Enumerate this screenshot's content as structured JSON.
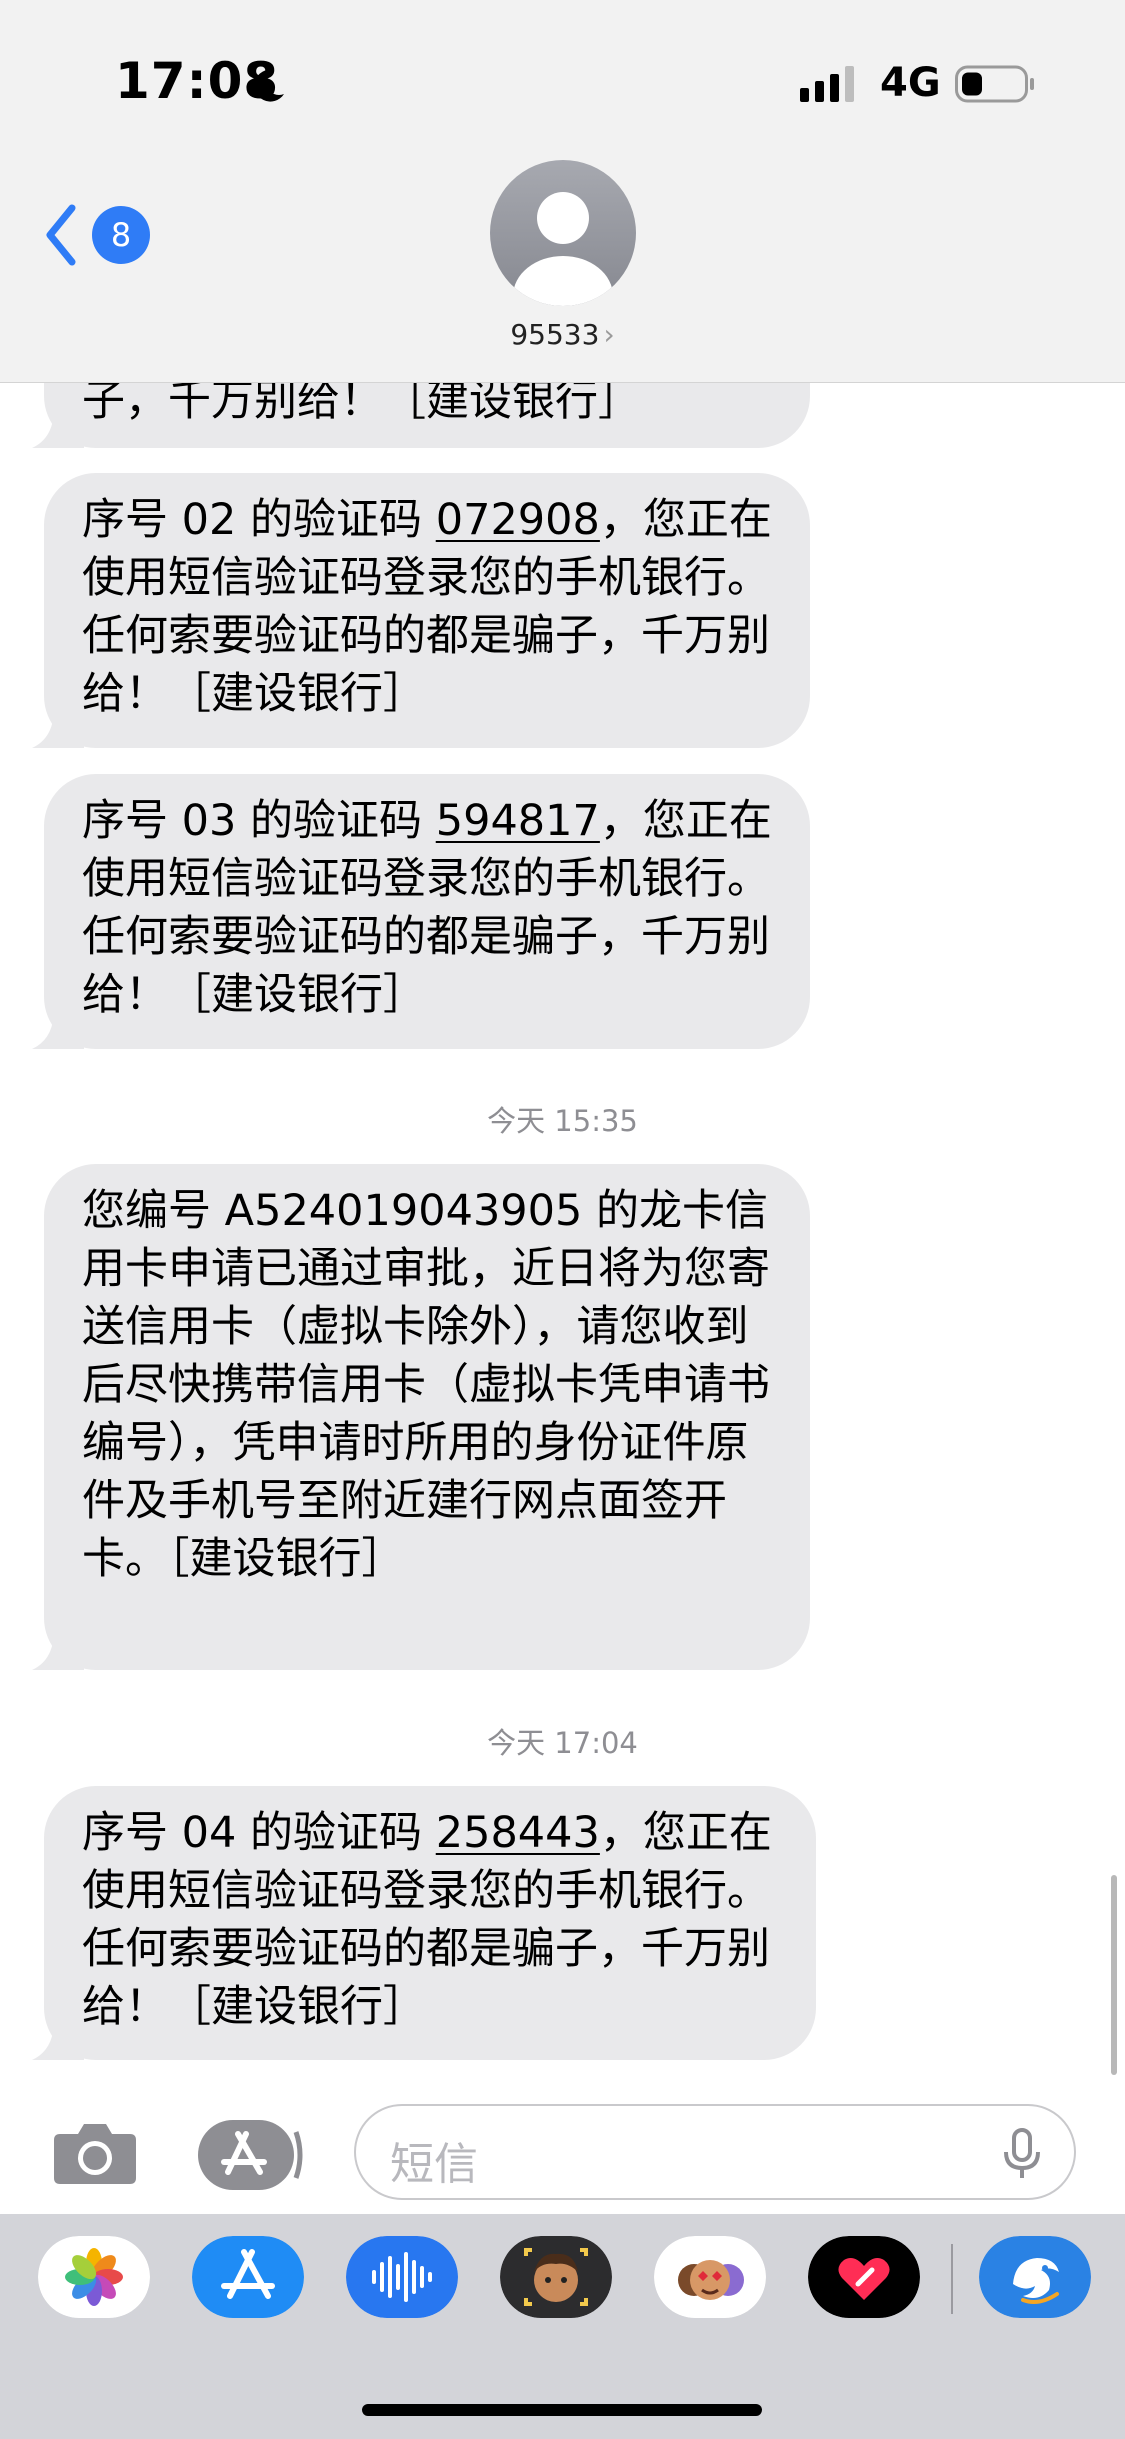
{
  "status_bar": {
    "time": "17:08",
    "network": "4G"
  },
  "header": {
    "back_badge": "8",
    "contact_name": "95533",
    "contact_chevron": "›"
  },
  "messages": [
    {
      "lines_before": "",
      "code": "",
      "text": "子，千万别给！［建设银行］"
    },
    {
      "prefix": "序号 02 的验证码 ",
      "code": "072908",
      "rest": "，您正在使用短信验证码登录您的手机银行。任何索要验证码的都是骗子，千万别给！［建设银行］"
    },
    {
      "prefix": "序号 03 的验证码 ",
      "code": "594817",
      "rest": "，您正在使用短信验证码登录您的手机银行。任何索要验证码的都是骗子，千万别给！［建设银行］"
    },
    {
      "text": "您编号 A524019043905 的龙卡信用卡申请已通过审批，近日将为您寄送信用卡（虚拟卡除外），请您收到后尽快携带信用卡（虚拟卡凭申请书编号），凭申请时所用的身份证件原件及手机号至附近建行网点面签开卡。［建设银行］"
    },
    {
      "prefix": "序号 04 的验证码 ",
      "code": "258443",
      "rest": "，您正在使用短信验证码登录您的手机银行。任何索要验证码的都是骗子，千万别给！［建设银行］"
    }
  ],
  "timestamps": [
    "今天 15:35",
    "今天 17:04"
  ],
  "input": {
    "placeholder": "短信"
  },
  "apps": [
    "photos-icon",
    "appstore-icon",
    "audio-icon",
    "memoji-icon",
    "animoji-icon",
    "digital-touch-icon",
    "ctrip-icon"
  ]
}
